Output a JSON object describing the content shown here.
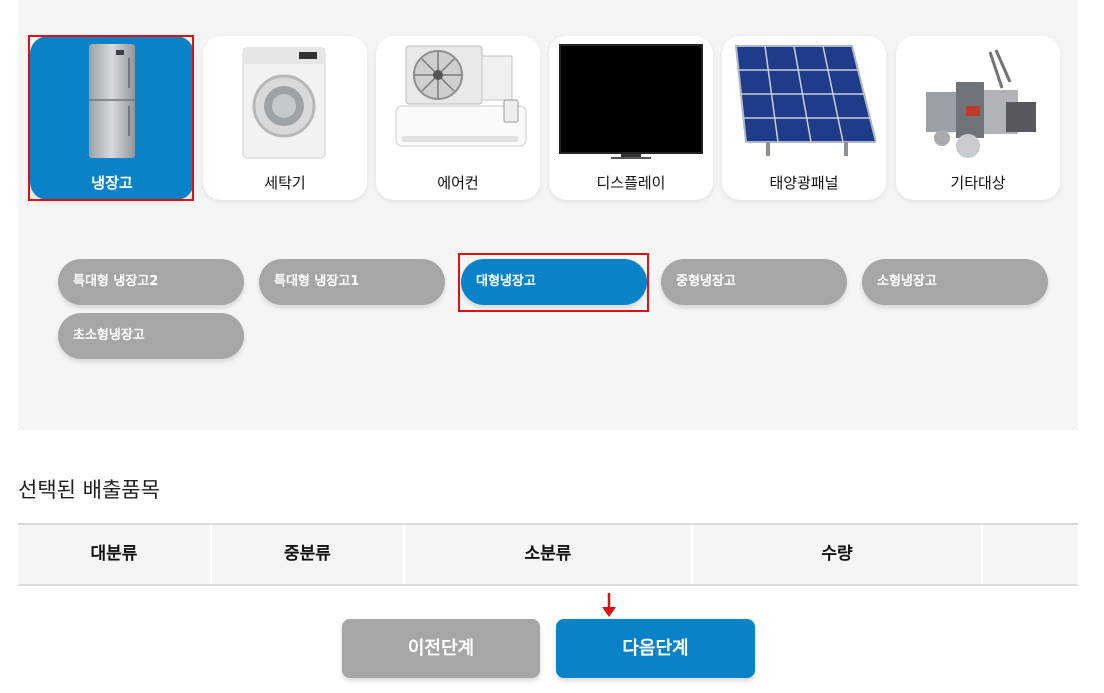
{
  "categories": [
    {
      "label": "냉장고",
      "icon": "refrigerator-icon",
      "active": true
    },
    {
      "label": "세탁기",
      "icon": "washing-machine-icon",
      "active": false
    },
    {
      "label": "에어컨",
      "icon": "air-conditioner-icon",
      "active": false
    },
    {
      "label": "디스플레이",
      "icon": "display-icon",
      "active": false
    },
    {
      "label": "태양광패널",
      "icon": "solar-panel-icon",
      "active": false
    },
    {
      "label": "기타대상",
      "icon": "misc-appliances-icon",
      "active": false
    }
  ],
  "subcategories": [
    {
      "label": "특대형 냉장고2",
      "active": false
    },
    {
      "label": "특대형 냉장고1",
      "active": false
    },
    {
      "label": "대형냉장고",
      "active": true
    },
    {
      "label": "중형냉장고",
      "active": false
    },
    {
      "label": "소형냉장고",
      "active": false
    },
    {
      "label": "초소형냉장고",
      "active": false
    }
  ],
  "selected": {
    "title": "선택된 배출품목",
    "columns": [
      "대분류",
      "중분류",
      "소분류",
      "수량",
      ""
    ]
  },
  "buttons": {
    "prev_label": "이전단계",
    "next_label": "다음단계"
  },
  "colors": {
    "accent": "#0a82c8",
    "inactive": "#a6a6a6",
    "highlight": "#e01010"
  }
}
